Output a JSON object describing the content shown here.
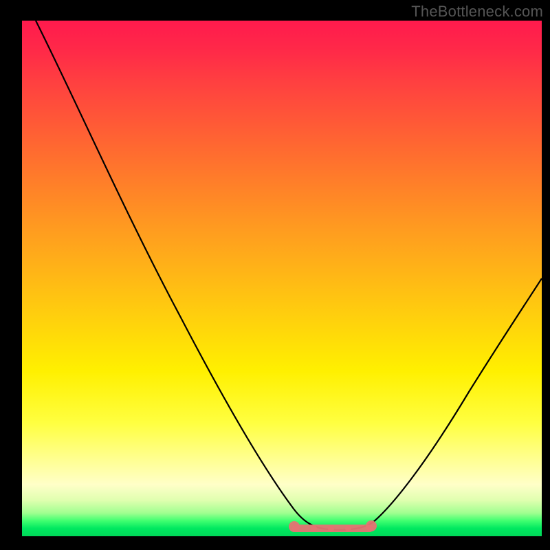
{
  "watermark": "TheBottleneck.com",
  "chart_data": {
    "type": "line",
    "title": "",
    "xlabel": "",
    "ylabel": "",
    "xlim": [
      0,
      100
    ],
    "ylim": [
      0,
      100
    ],
    "grid": false,
    "series": [
      {
        "name": "bottleneck-curve",
        "x": [
          0,
          6,
          12,
          18,
          24,
          30,
          36,
          42,
          48,
          52,
          55,
          58,
          62,
          66,
          72,
          80,
          88,
          96,
          100
        ],
        "y": [
          100,
          88,
          76,
          64,
          52,
          40,
          28,
          18,
          10,
          5,
          3,
          2,
          2,
          3,
          8,
          18,
          30,
          43,
          50
        ]
      }
    ],
    "annotations": [
      {
        "name": "flat-bottom-highlight",
        "x_start": 52,
        "x_end": 66,
        "y": 2
      }
    ],
    "background_gradient": {
      "top": "#ff1a4d",
      "upper_mid": "#ff9a20",
      "mid": "#fff000",
      "lower_mid": "#ffff90",
      "bottom": "#00d858"
    }
  }
}
